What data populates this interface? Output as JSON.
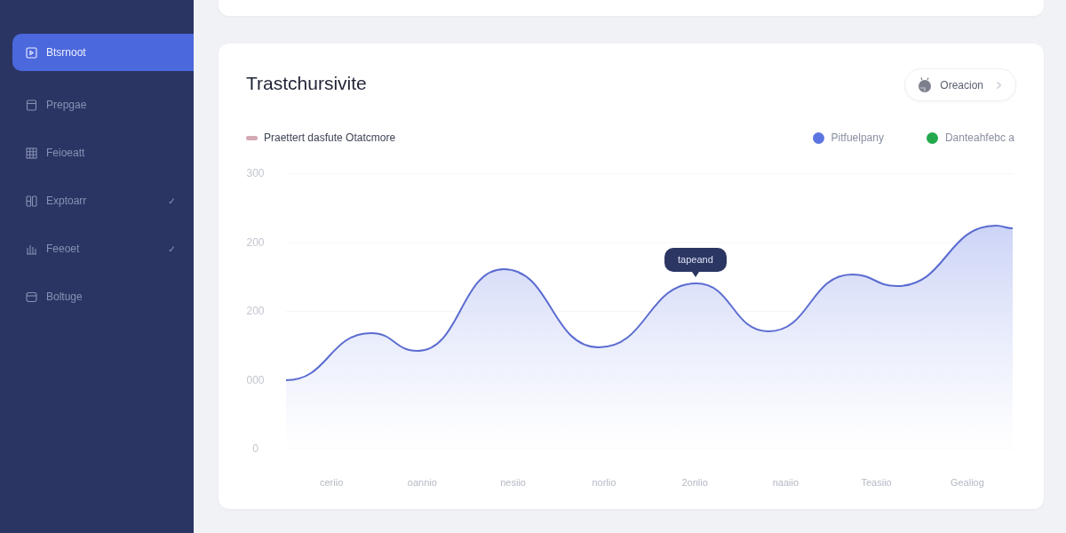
{
  "sidebar": {
    "items": [
      {
        "label": "Btsrnoot",
        "selected": true,
        "expandable": false
      },
      {
        "label": "Prepgae",
        "selected": false,
        "expandable": false
      },
      {
        "label": "Feioeatt",
        "selected": false,
        "expandable": false
      },
      {
        "label": "Exptoarr",
        "selected": false,
        "expandable": true
      },
      {
        "label": "Feeoet",
        "selected": false,
        "expandable": true
      },
      {
        "label": "Boltuge",
        "selected": false,
        "expandable": false
      }
    ]
  },
  "chart_card": {
    "title": "Trastchursivite",
    "action_button": {
      "label": "Oreacion"
    },
    "legend": [
      {
        "kind": "bar",
        "label": "Praettert dasfute Otatcmore",
        "color": "#d6aab4"
      },
      {
        "kind": "dot",
        "label": "Pitfuelpany",
        "color": "#5b76e2"
      },
      {
        "kind": "dot",
        "label": "Danteahfebc a",
        "color": "#23a84e"
      }
    ],
    "y_axis_labels": [
      "300",
      "200",
      "200",
      "000",
      "0"
    ],
    "x_axis_labels": [
      "ceriio",
      "oannio",
      "nesiio",
      "norlio",
      "2onlio",
      "naaiio",
      "Teasiio",
      "Gealiog"
    ],
    "tooltip": {
      "label": "tapeand"
    }
  }
}
